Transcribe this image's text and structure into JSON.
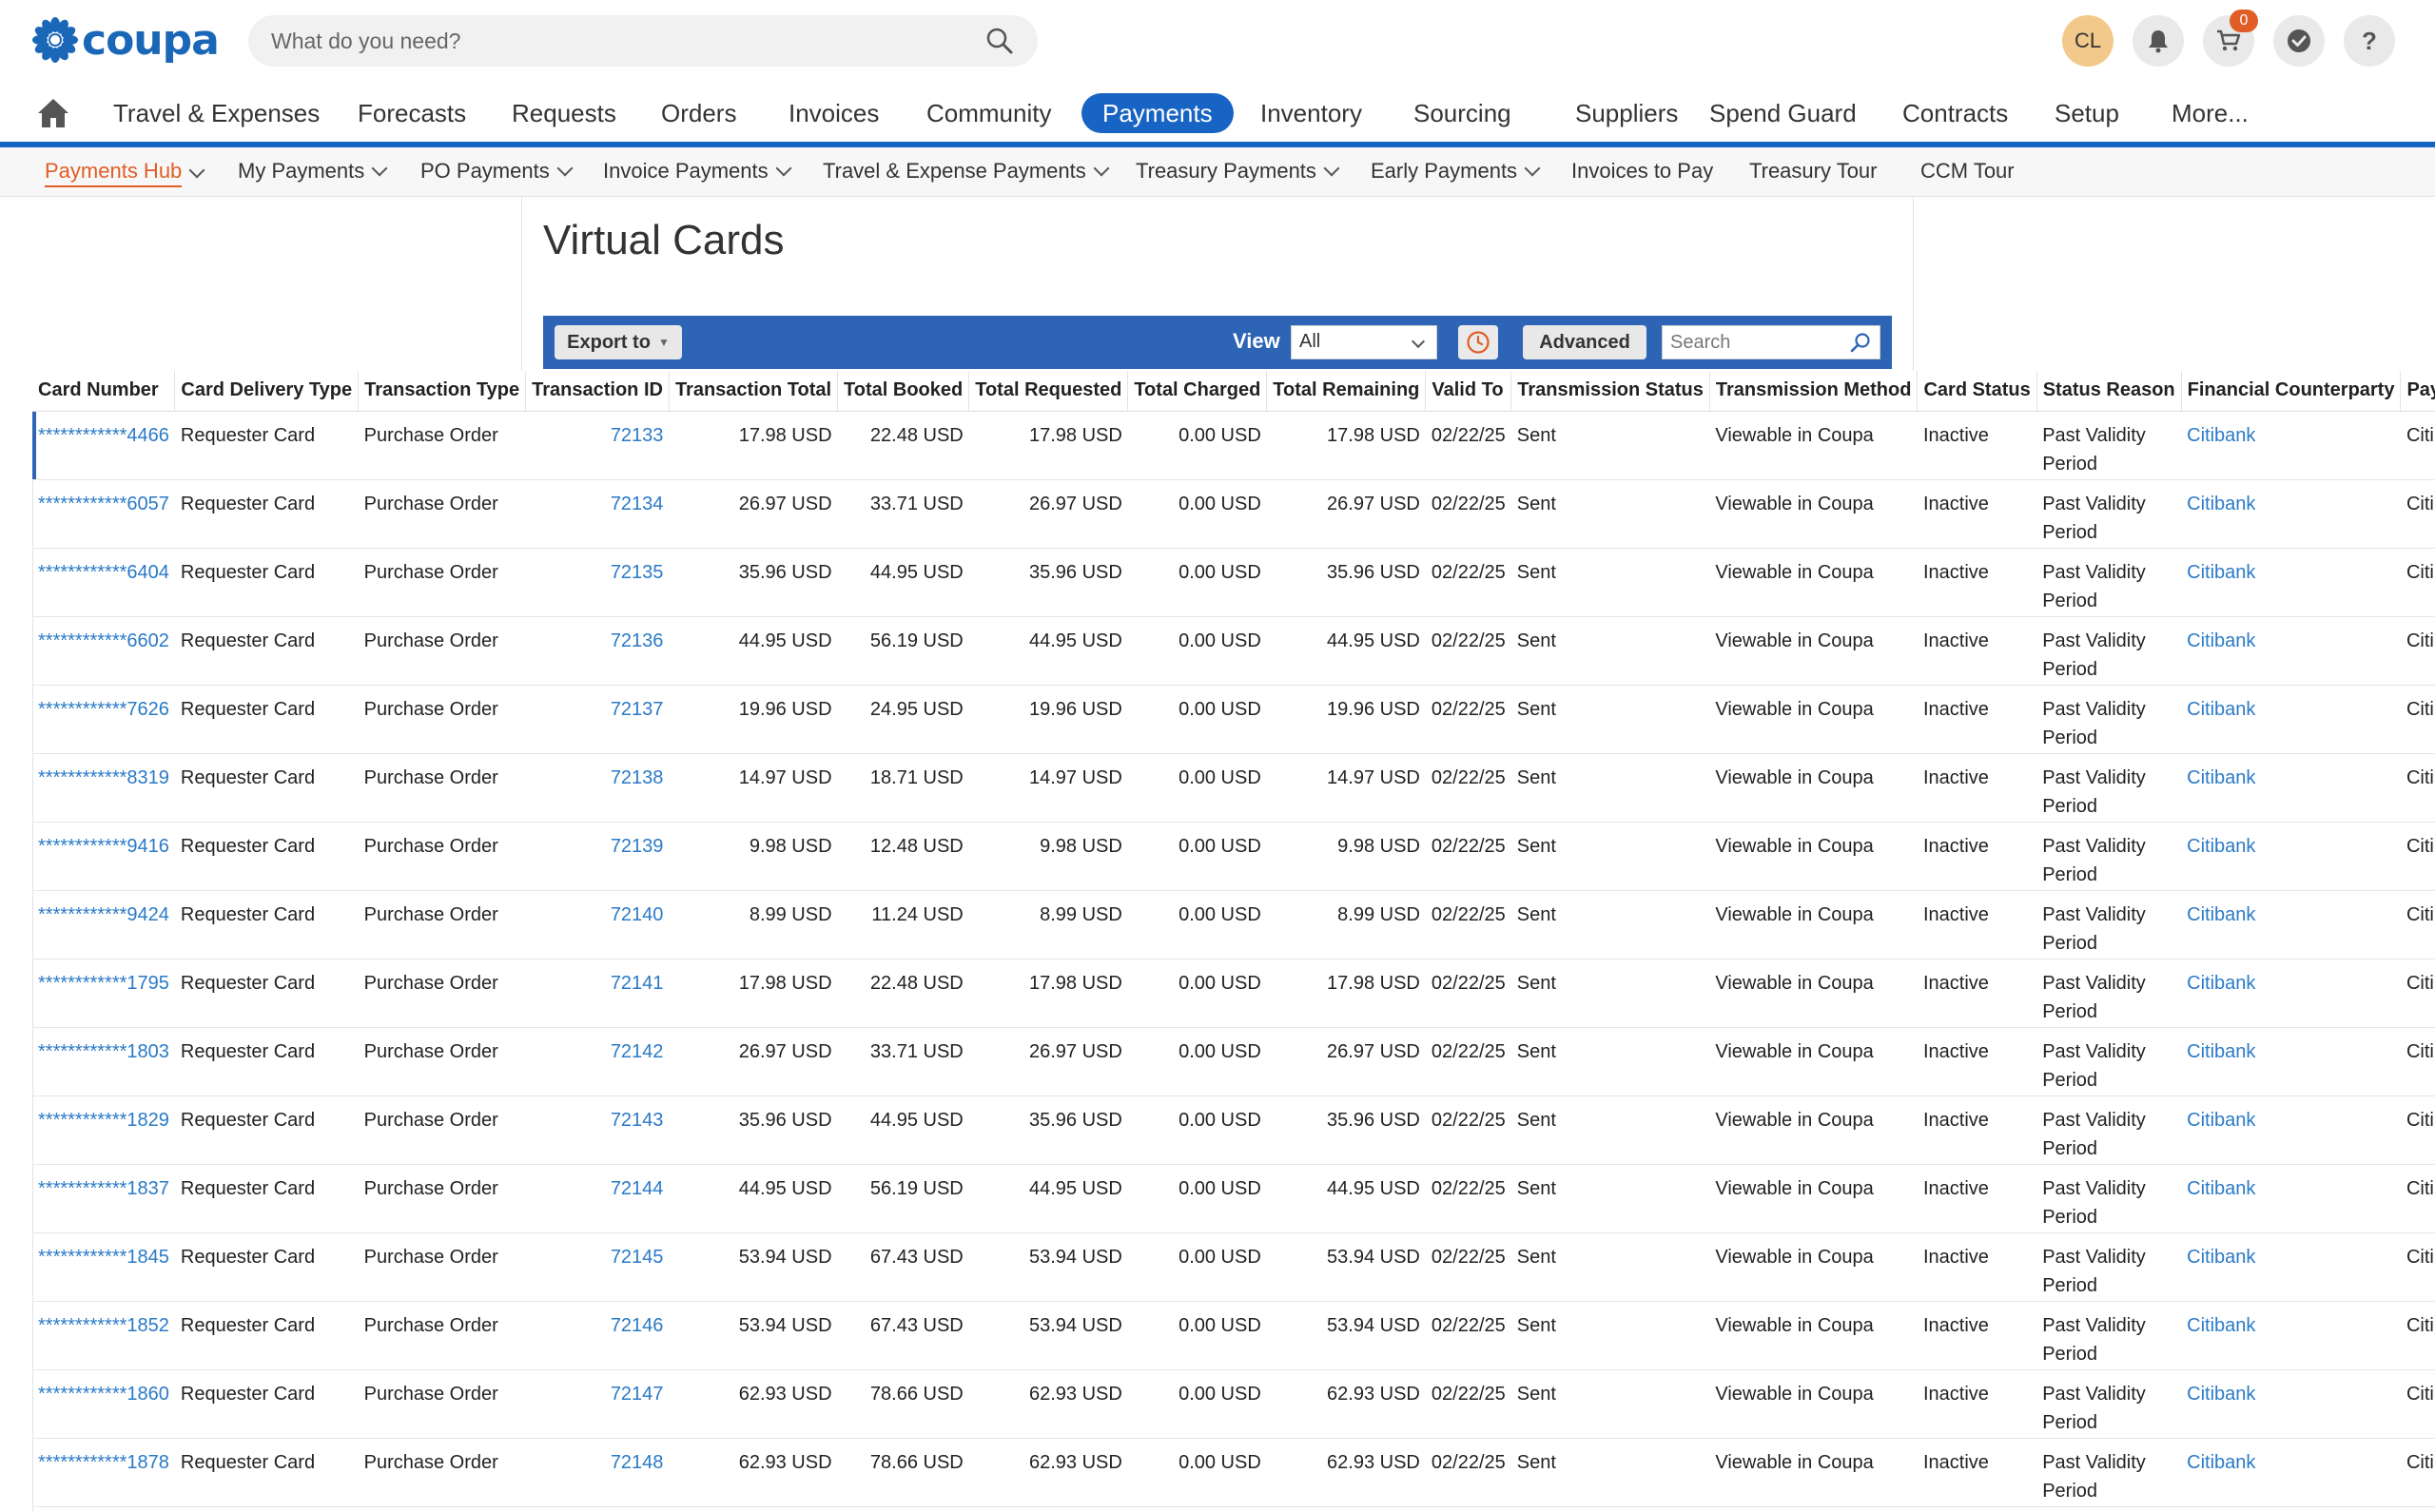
{
  "header": {
    "logo_text": "coupa",
    "search_placeholder": "What do you need?",
    "avatar_initials": "CL",
    "cart_count": "0",
    "icons": [
      "bell-icon",
      "cart-icon",
      "check-circle-icon",
      "help-icon"
    ]
  },
  "nav": {
    "items": [
      "Travel & Expenses",
      "Forecasts",
      "Requests",
      "Orders",
      "Invoices",
      "Community",
      "Payments",
      "Inventory",
      "Sourcing",
      "Suppliers",
      "Spend Guard",
      "Contracts",
      "Setup",
      "More..."
    ],
    "active": "Payments"
  },
  "subnav": {
    "items": [
      "Payments Hub",
      "My Payments",
      "PO Payments",
      "Invoice Payments",
      "Travel & Expense Payments",
      "Treasury Payments",
      "Early Payments",
      "Invoices to Pay",
      "Treasury Tour",
      "CCM Tour"
    ],
    "active": "Payments Hub"
  },
  "page": {
    "title": "Virtual Cards"
  },
  "toolbar": {
    "export_label": "Export to",
    "view_label": "View",
    "view_value": "All",
    "advanced_label": "Advanced",
    "search_placeholder": "Search"
  },
  "table": {
    "columns": [
      "Card Number",
      "Card Delivery Type",
      "Transaction Type",
      "Transaction ID",
      "Transaction Total",
      "Total Booked",
      "Total Requested",
      "Total Charged",
      "Total Remaining",
      "Valid To",
      "Transmission Status",
      "Transmission Method",
      "Card Status",
      "Status Reason",
      "Financial Counterparty",
      "Payme"
    ],
    "rows": [
      [
        "************4466",
        "Requester Card",
        "Purchase Order",
        "72133",
        "17.98 USD",
        "22.48 USD",
        "17.98 USD",
        "0.00 USD",
        "17.98 USD",
        "02/22/25",
        "Sent",
        "Viewable in Coupa",
        "Inactive",
        "Past Validity Period",
        "Citibank",
        "Citibank"
      ],
      [
        "************6057",
        "Requester Card",
        "Purchase Order",
        "72134",
        "26.97 USD",
        "33.71 USD",
        "26.97 USD",
        "0.00 USD",
        "26.97 USD",
        "02/22/25",
        "Sent",
        "Viewable in Coupa",
        "Inactive",
        "Past Validity Period",
        "Citibank",
        "Citibank"
      ],
      [
        "************6404",
        "Requester Card",
        "Purchase Order",
        "72135",
        "35.96 USD",
        "44.95 USD",
        "35.96 USD",
        "0.00 USD",
        "35.96 USD",
        "02/22/25",
        "Sent",
        "Viewable in Coupa",
        "Inactive",
        "Past Validity Period",
        "Citibank",
        "Citibank"
      ],
      [
        "************6602",
        "Requester Card",
        "Purchase Order",
        "72136",
        "44.95 USD",
        "56.19 USD",
        "44.95 USD",
        "0.00 USD",
        "44.95 USD",
        "02/22/25",
        "Sent",
        "Viewable in Coupa",
        "Inactive",
        "Past Validity Period",
        "Citibank",
        "Citibank"
      ],
      [
        "************7626",
        "Requester Card",
        "Purchase Order",
        "72137",
        "19.96 USD",
        "24.95 USD",
        "19.96 USD",
        "0.00 USD",
        "19.96 USD",
        "02/22/25",
        "Sent",
        "Viewable in Coupa",
        "Inactive",
        "Past Validity Period",
        "Citibank",
        "Citibank"
      ],
      [
        "************8319",
        "Requester Card",
        "Purchase Order",
        "72138",
        "14.97 USD",
        "18.71 USD",
        "14.97 USD",
        "0.00 USD",
        "14.97 USD",
        "02/22/25",
        "Sent",
        "Viewable in Coupa",
        "Inactive",
        "Past Validity Period",
        "Citibank",
        "Citibank"
      ],
      [
        "************9416",
        "Requester Card",
        "Purchase Order",
        "72139",
        "9.98 USD",
        "12.48 USD",
        "9.98 USD",
        "0.00 USD",
        "9.98 USD",
        "02/22/25",
        "Sent",
        "Viewable in Coupa",
        "Inactive",
        "Past Validity Period",
        "Citibank",
        "Citibank"
      ],
      [
        "************9424",
        "Requester Card",
        "Purchase Order",
        "72140",
        "8.99 USD",
        "11.24 USD",
        "8.99 USD",
        "0.00 USD",
        "8.99 USD",
        "02/22/25",
        "Sent",
        "Viewable in Coupa",
        "Inactive",
        "Past Validity Period",
        "Citibank",
        "Citibank"
      ],
      [
        "************1795",
        "Requester Card",
        "Purchase Order",
        "72141",
        "17.98 USD",
        "22.48 USD",
        "17.98 USD",
        "0.00 USD",
        "17.98 USD",
        "02/22/25",
        "Sent",
        "Viewable in Coupa",
        "Inactive",
        "Past Validity Period",
        "Citibank",
        "Citibank"
      ],
      [
        "************1803",
        "Requester Card",
        "Purchase Order",
        "72142",
        "26.97 USD",
        "33.71 USD",
        "26.97 USD",
        "0.00 USD",
        "26.97 USD",
        "02/22/25",
        "Sent",
        "Viewable in Coupa",
        "Inactive",
        "Past Validity Period",
        "Citibank",
        "Citibank"
      ],
      [
        "************1829",
        "Requester Card",
        "Purchase Order",
        "72143",
        "35.96 USD",
        "44.95 USD",
        "35.96 USD",
        "0.00 USD",
        "35.96 USD",
        "02/22/25",
        "Sent",
        "Viewable in Coupa",
        "Inactive",
        "Past Validity Period",
        "Citibank",
        "Citibank"
      ],
      [
        "************1837",
        "Requester Card",
        "Purchase Order",
        "72144",
        "44.95 USD",
        "56.19 USD",
        "44.95 USD",
        "0.00 USD",
        "44.95 USD",
        "02/22/25",
        "Sent",
        "Viewable in Coupa",
        "Inactive",
        "Past Validity Period",
        "Citibank",
        "Citibank"
      ],
      [
        "************1845",
        "Requester Card",
        "Purchase Order",
        "72145",
        "53.94 USD",
        "67.43 USD",
        "53.94 USD",
        "0.00 USD",
        "53.94 USD",
        "02/22/25",
        "Sent",
        "Viewable in Coupa",
        "Inactive",
        "Past Validity Period",
        "Citibank",
        "Citibank"
      ],
      [
        "************1852",
        "Requester Card",
        "Purchase Order",
        "72146",
        "53.94 USD",
        "67.43 USD",
        "53.94 USD",
        "0.00 USD",
        "53.94 USD",
        "02/22/25",
        "Sent",
        "Viewable in Coupa",
        "Inactive",
        "Past Validity Period",
        "Citibank",
        "Citibank"
      ],
      [
        "************1860",
        "Requester Card",
        "Purchase Order",
        "72147",
        "62.93 USD",
        "78.66 USD",
        "62.93 USD",
        "0.00 USD",
        "62.93 USD",
        "02/22/25",
        "Sent",
        "Viewable in Coupa",
        "Inactive",
        "Past Validity Period",
        "Citibank",
        "Citibank"
      ],
      [
        "************1878",
        "Requester Card",
        "Purchase Order",
        "72148",
        "62.93 USD",
        "78.66 USD",
        "62.93 USD",
        "0.00 USD",
        "62.93 USD",
        "02/22/25",
        "Sent",
        "Viewable in Coupa",
        "Inactive",
        "Past Validity Period",
        "Citibank",
        "Citibank"
      ]
    ]
  },
  "colors": {
    "brand_blue": "#1864c4",
    "toolbar_blue": "#2d64b5",
    "link_blue": "#2a7ac7",
    "accent_orange": "#e05d25",
    "avatar_bg": "#f3c98b"
  }
}
